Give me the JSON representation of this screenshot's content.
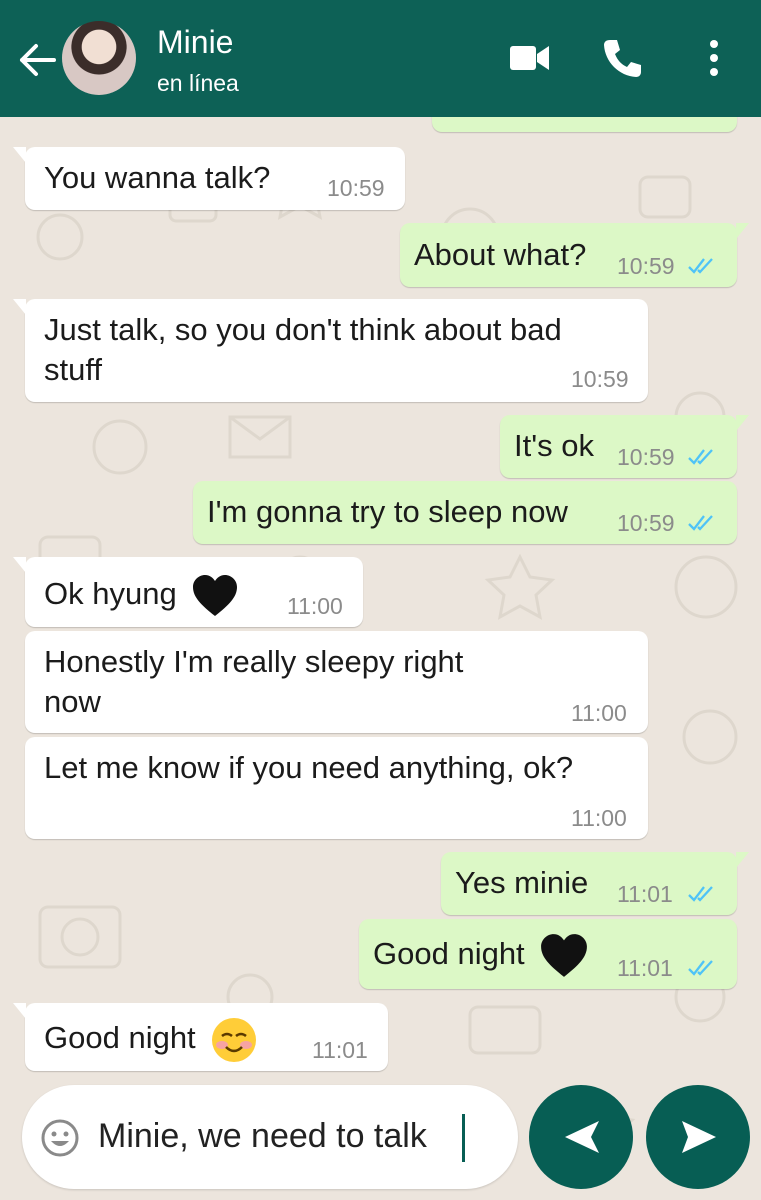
{
  "header": {
    "contact_name": "Minie",
    "status": "en línea",
    "icons": [
      "back-arrow-icon",
      "avatar",
      "video-call-icon",
      "phone-icon",
      "more-options-icon"
    ]
  },
  "colors": {
    "header": "#0d6156",
    "chat_background": "#ece5dd",
    "incoming_bubble": "#ffffff",
    "outgoing_bubble": "#dcf8c6",
    "read_ticks": "#4fc3f7",
    "fab": "#075e54"
  },
  "messages": [
    {
      "direction": "in",
      "text": "You wanna talk?",
      "time": "10:59"
    },
    {
      "direction": "out",
      "text": "About what?",
      "time": "10:59",
      "status": "read"
    },
    {
      "direction": "in",
      "text": "Just talk, so you don't think about bad stuff",
      "time": "10:59"
    },
    {
      "direction": "out",
      "text": "It's ok",
      "time": "10:59",
      "status": "read"
    },
    {
      "direction": "out",
      "text": "I'm gonna try to sleep now",
      "time": "10:59",
      "status": "read"
    },
    {
      "direction": "in",
      "text": "Ok hyung",
      "emoji": "black-heart",
      "time": "11:00"
    },
    {
      "direction": "in",
      "text": "Honestly I'm really sleepy right now",
      "time": "11:00"
    },
    {
      "direction": "in",
      "text": "Let me know if you need anything, ok?",
      "time": "11:00"
    },
    {
      "direction": "out",
      "text": "Yes minie",
      "time": "11:01",
      "status": "read"
    },
    {
      "direction": "out",
      "text": "Good night",
      "emoji": "black-heart",
      "time": "11:01",
      "status": "read"
    },
    {
      "direction": "in",
      "text": "Good night",
      "emoji": "smiling-face",
      "time": "11:01"
    }
  ],
  "composer": {
    "text": "Minie, we need to talk",
    "icons": [
      "emoji-icon",
      "left-arrow-icon",
      "send-icon"
    ]
  }
}
